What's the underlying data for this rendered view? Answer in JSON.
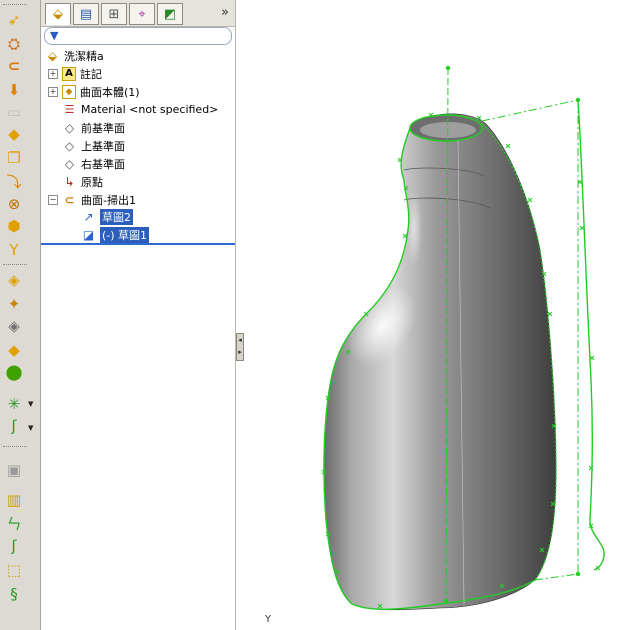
{
  "tree": {
    "root": "洗潔精a",
    "items": [
      {
        "label": "註記"
      },
      {
        "label": "曲面本體(1)"
      },
      {
        "label": "Material <not specified>"
      },
      {
        "label": "前基準面"
      },
      {
        "label": "上基準面"
      },
      {
        "label": "右基準面"
      },
      {
        "label": "原點"
      },
      {
        "label": "曲面-掃出1"
      },
      {
        "label": "草圖2"
      },
      {
        "label": "(-) 草圖1"
      }
    ]
  },
  "tabs": {
    "more": "»"
  },
  "graphics": {
    "triad_label": "Y"
  },
  "colors": {
    "sketch": "#22cc22",
    "selection": "#2c5fbd",
    "rollback": "#2e6bd0"
  }
}
